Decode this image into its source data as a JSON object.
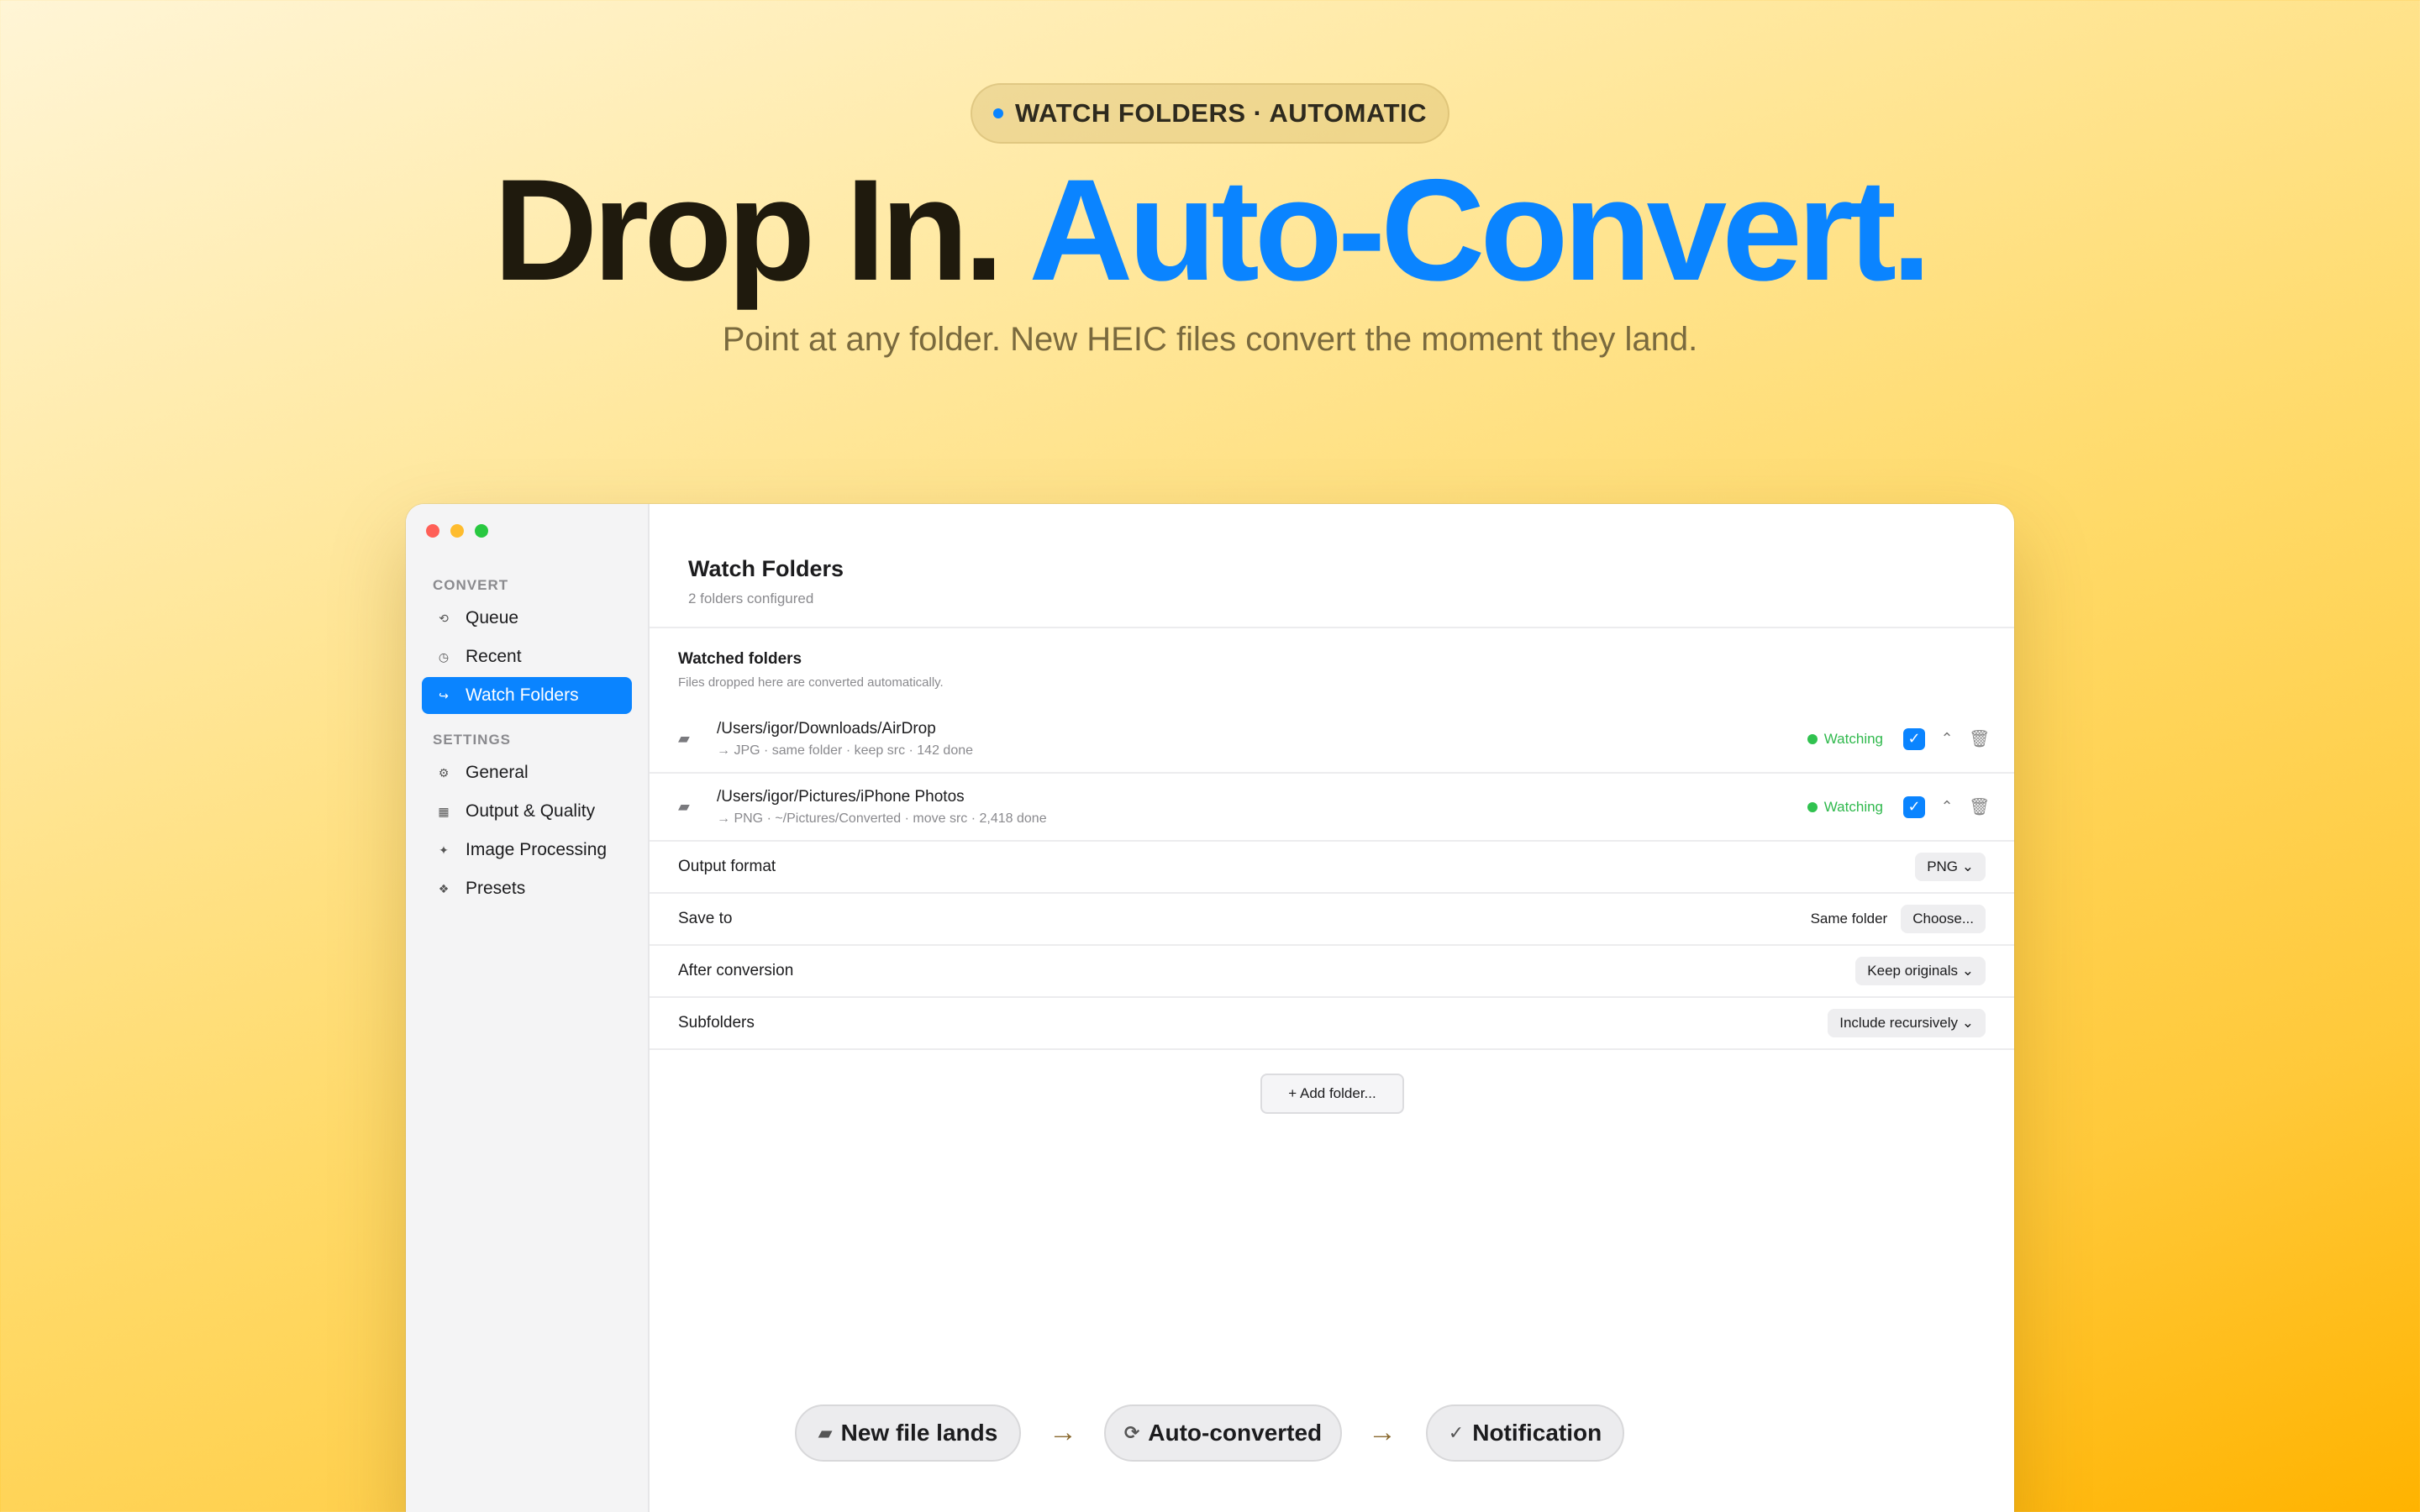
{
  "hero": {
    "badge": "WATCH FOLDERS · AUTOMATIC",
    "headline_part1": "Drop In.",
    "headline_part2": "Auto-Convert.",
    "subline": "Point at any folder. New HEIC files convert the moment they land."
  },
  "colors": {
    "accent": "#0a84ff",
    "watching": "#30b94d",
    "background_gradient": [
      "#fff5d6",
      "#ffb300"
    ]
  },
  "sidebar": {
    "sections": [
      {
        "title": "CONVERT",
        "items": [
          {
            "label": "Queue",
            "icon": "queue-icon"
          },
          {
            "label": "Recent",
            "icon": "clock-icon"
          },
          {
            "label": "Watch Folders",
            "icon": "watch-folders-icon",
            "active": true
          }
        ]
      },
      {
        "title": "SETTINGS",
        "items": [
          {
            "label": "General",
            "icon": "gear-icon"
          },
          {
            "label": "Output & Quality",
            "icon": "output-icon"
          },
          {
            "label": "Image Processing",
            "icon": "sparkle-icon"
          },
          {
            "label": "Presets",
            "icon": "presets-icon"
          }
        ]
      }
    ]
  },
  "main": {
    "title": "Watch Folders",
    "subtitle": "2 folders configured",
    "section_title": "Watched folders",
    "section_subtitle": "Files dropped here are converted automatically.",
    "folders": [
      {
        "path": "/Users/igor/Downloads/AirDrop",
        "meta": "→ JPG · same folder · keep src · 142 done",
        "status": "Watching",
        "enabled": true
      },
      {
        "path": "/Users/igor/Pictures/iPhone Photos",
        "meta": "→ PNG · ~/Pictures/Converted · move src · 2,418 done",
        "status": "Watching",
        "enabled": true
      }
    ],
    "settings": {
      "output_format": {
        "label": "Output format",
        "value": "PNG ⌄"
      },
      "save_to": {
        "label": "Save to",
        "value": "Same folder",
        "button": "Choose..."
      },
      "after_conversion": {
        "label": "After conversion",
        "value": "Keep originals ⌄"
      },
      "subfolders": {
        "label": "Subfolders",
        "value": "Include recursively ⌄"
      }
    },
    "add_folder": "+ Add folder..."
  },
  "flow": {
    "steps": [
      {
        "label": "New file lands",
        "icon": "folder-icon"
      },
      {
        "label": "Auto-converted",
        "icon": "refresh-icon"
      },
      {
        "label": "Notification",
        "icon": "checkmark-icon"
      }
    ]
  }
}
